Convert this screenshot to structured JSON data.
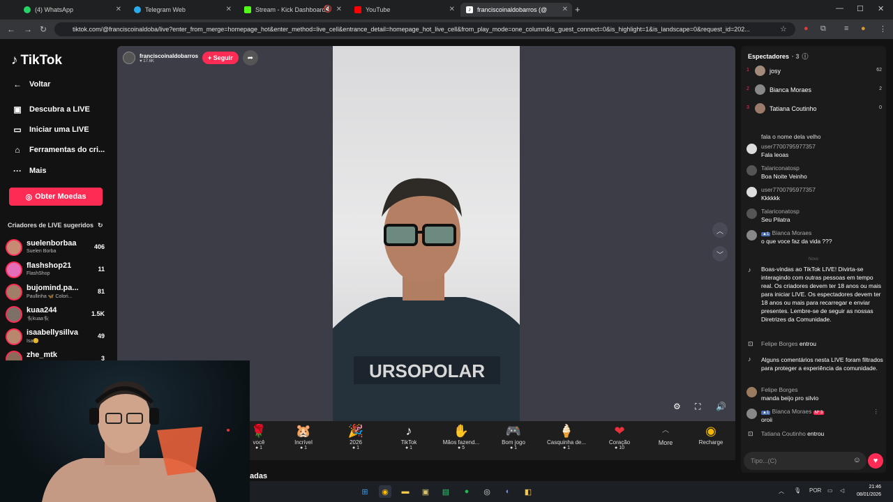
{
  "browser": {
    "tabs": [
      {
        "title": "(4) WhatsApp",
        "color": "#25d366"
      },
      {
        "title": "Telegram Web",
        "color": "#2aabee"
      },
      {
        "title": "Stream - Kick Dashboard",
        "color": "#53fc18"
      },
      {
        "title": "YouTube",
        "color": "#ff0000"
      },
      {
        "title": "franciscoinaldobarros (@fra",
        "color": "#ffffff"
      }
    ],
    "url": "tiktok.com/@franciscoinaldoba/live?enter_from_merge=homepage_hot&enter_method=live_cell&entrance_detail=homepage_hot_live_cell&from_play_mode=one_column&is_guest_connect=0&is_highlight=1&is_landscape=0&request_id=202..."
  },
  "sidebar": {
    "logo": "TikTok",
    "back": "Voltar",
    "items": [
      {
        "label": "Descubra a LIVE"
      },
      {
        "label": "Iniciar uma LIVE"
      },
      {
        "label": "Ferramentas do cri..."
      },
      {
        "label": "Mais"
      }
    ],
    "coins_button": "Obter Moedas",
    "suggested_header": "Criadores de LIVE sugeridos",
    "creators": [
      {
        "name": "suelenborbaa",
        "sub": "Suelen Borba",
        "count": "406"
      },
      {
        "name": "flashshop21",
        "sub": "FlashShop",
        "count": "11"
      },
      {
        "name": "bujomind.pa...",
        "sub": "Paullinha 🦋 Colori...",
        "count": "81"
      },
      {
        "name": "kuaa244",
        "sub": "🐈‍⬛kuaa🐈‍⬛",
        "count": "1.5K"
      },
      {
        "name": "isaabellysillva",
        "sub": "Isa😊",
        "count": "49"
      },
      {
        "name": "zhe_mtk",
        "sub": "",
        "count": "3"
      }
    ]
  },
  "video": {
    "host": "franciscoinaldobarros",
    "likes": "17.6K",
    "follow": "+ Seguir"
  },
  "gifts": [
    {
      "name": "você",
      "price": "1",
      "icon": "🌹"
    },
    {
      "name": "Incrível",
      "price": "1",
      "icon": "🐹"
    },
    {
      "name": "2026",
      "price": "1",
      "icon": "🎉"
    },
    {
      "name": "TikTok",
      "price": "1",
      "icon": "♪"
    },
    {
      "name": "Mãos fazend...",
      "price": "5",
      "icon": "✋"
    },
    {
      "name": "Bom jogo",
      "price": "1",
      "icon": "🎮"
    },
    {
      "name": "Casquinha de...",
      "price": "1",
      "icon": "🍦"
    },
    {
      "name": "Coração",
      "price": "10",
      "icon": "❤"
    }
  ],
  "gifts_more": "More",
  "recharge": "Recharge",
  "panel": {
    "viewers_header": "Espectadores",
    "viewers_count": "3",
    "viewers": [
      {
        "rank": "1",
        "name": "josy",
        "count": "62"
      },
      {
        "rank": "2",
        "name": "Bianca Moraes",
        "count": "2"
      },
      {
        "rank": "3",
        "name": "Tatiana Coutinho",
        "count": "0"
      }
    ],
    "chat_top": "fala o nome dela velho",
    "messages": [
      {
        "user": "user7700795977357",
        "text": "Fala leoas"
      },
      {
        "user": "Talariconatosp",
        "text": "Boa Noite Veinho"
      },
      {
        "user": "user7700795977357",
        "text": "Kkkkkk"
      },
      {
        "user": "Talariconatosp",
        "text": "Seu Pilatra"
      },
      {
        "user": "Bianca Moraes",
        "text": "o que voce faz da vida ???"
      }
    ],
    "new_divider": "Novo",
    "welcome": "Boas-vindas ao TikTok LIVE! Divirta-se interagindo com outras pessoas em tempo real. Os criadores devem ter 18 anos ou mais para iniciar LIVE. Os espectadores devem ter 18 anos ou mais para recarregar e enviar presentes. Lembre-se de seguir as nossas Diretrizes da Comunidade.",
    "join1_user": "Felipe Borges",
    "join_word": "entrou",
    "filter_msg": "Alguns comentários nesta LIVE foram filtrados para proteger a experiência da comunidade.",
    "msg_felipe": {
      "user": "Felipe Borges",
      "text": "manda beijo pro silvio"
    },
    "msg_bianca": {
      "user": "Bianca Moraes",
      "badge": "Nº 3",
      "text": "oroii"
    },
    "join2_user": "Tatiana Coutinho",
    "input_placeholder": "Tipo...(C)"
  },
  "taskbar": {
    "lang": "POR",
    "time": "21:46",
    "date": "08/01/2026"
  },
  "cut_text": "adas"
}
